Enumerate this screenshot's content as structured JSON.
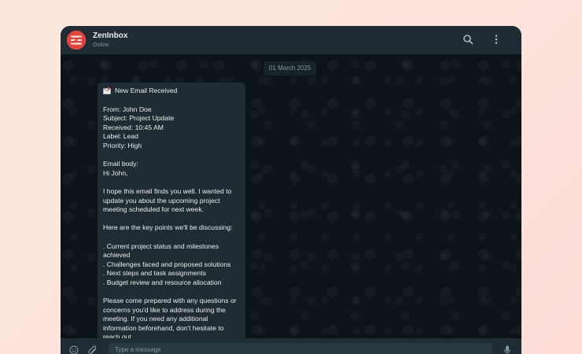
{
  "header": {
    "app_name": "ZenInbox",
    "status": "Online",
    "icons": [
      "search-icon",
      "more-vertical-icon"
    ]
  },
  "chat": {
    "date_chip": "01 March 2025",
    "message": {
      "title": "New Email Received",
      "title_icon": "envelope-icon",
      "meta": [
        "From: John Doe",
        "Subject: Project Update",
        "Received: 10:45 AM",
        "Label: Lead",
        "Priority: High"
      ],
      "body_label": "Email body:",
      "greeting": "Hi John,",
      "paragraph_1": "I hope this email finds you well. I wanted to update you about the upcoming project meeting scheduled for next week.",
      "points_intro": "Here are the key points we'll be discussing:",
      "points": [
        ". Current project status and milestones achieved",
        ". Challenges faced and proposed solutions",
        ". Next steps and task assignments",
        ". Budget review and resource allocation"
      ],
      "paragraph_2": "Please come prepared with any questions or concerns you'd like to address during the meeting. If you need any additional information beforehand, don't hesitate to reach out."
    }
  },
  "footer": {
    "input_placeholder": "Type a message",
    "icons": [
      "emoji-icon",
      "attach-icon",
      "microphone-icon"
    ]
  },
  "colors": {
    "header_bg": "#202c33",
    "chat_bg": "#0b141a",
    "bubble_bg": "#202c33",
    "text": "#e9edef",
    "muted": "#8696a0",
    "brand_red": "#e8413a"
  }
}
